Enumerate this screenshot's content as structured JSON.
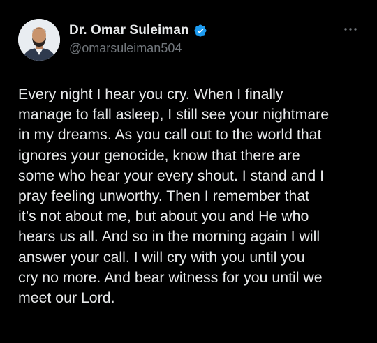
{
  "author": {
    "display_name": "Dr. Omar Suleiman",
    "handle": "@omarsuleiman504",
    "verified": true,
    "badge_color": "#1d9bf0"
  },
  "post": {
    "lines": [
      "Every night I hear you cry. When I finally",
      "manage to fall asleep, I still see your nightmare",
      "in my dreams. As you call out to the world that",
      "ignores your genocide, know that there are",
      "some who hear your every shout. I stand and I",
      "pray feeling unworthy. Then I remember that",
      "it’s not about me, but about you and He who",
      "hears us all. And so in the morning again I will",
      "answer your call. I will cry with you until you",
      "cry no more. And bear witness for you until we",
      "meet our Lord."
    ]
  },
  "icons": {
    "avatar": "avatar",
    "verified": "verified-badge-icon",
    "more": "more-options-icon"
  },
  "colors": {
    "background": "#000000",
    "text": "#e7e9ea",
    "secondary_text": "#71767b"
  }
}
